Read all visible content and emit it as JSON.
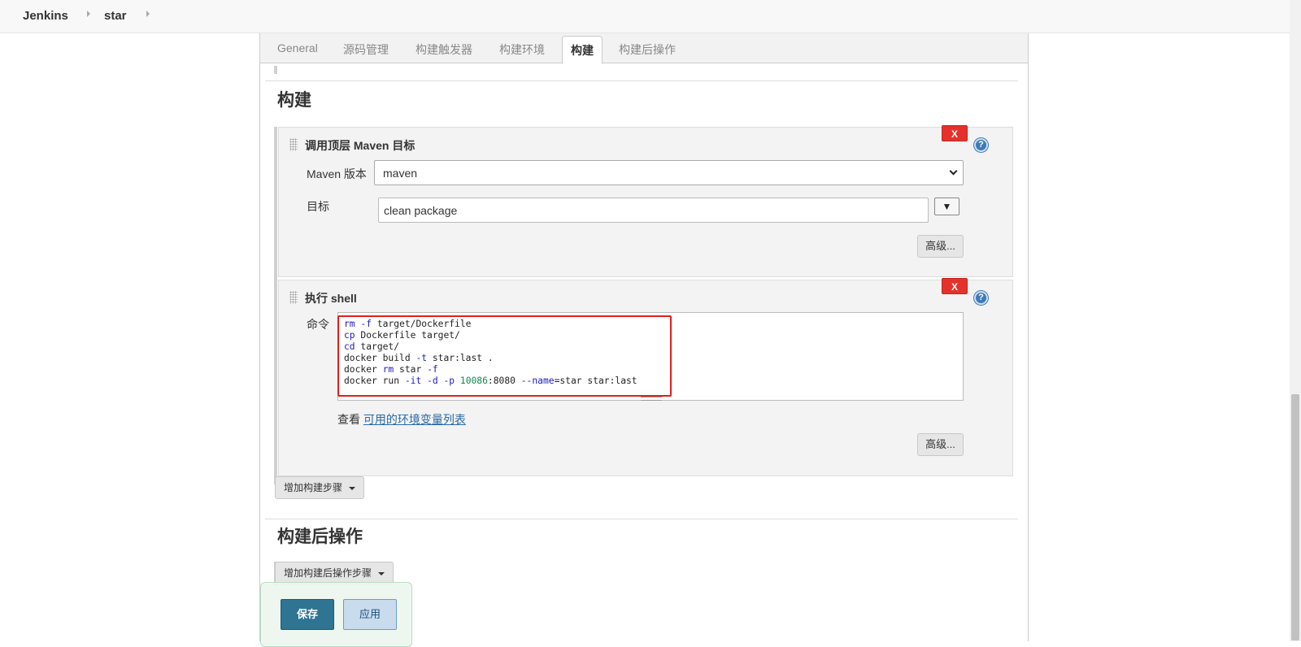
{
  "breadcrumb": {
    "items": [
      "Jenkins",
      "star"
    ]
  },
  "tabs": [
    {
      "label": "General",
      "active": false
    },
    {
      "label": "源码管理",
      "active": false
    },
    {
      "label": "构建触发器",
      "active": false
    },
    {
      "label": "构建环境",
      "active": false
    },
    {
      "label": "构建",
      "active": true
    },
    {
      "label": "构建后操作",
      "active": false
    }
  ],
  "build_section": {
    "title": "构建",
    "maven_step": {
      "title": "调用顶层 Maven 目标",
      "delete_label": "X",
      "help_label": "?",
      "maven_version_label": "Maven 版本",
      "maven_version_value": "maven",
      "goals_label": "目标",
      "goals_value": "clean package",
      "expand_label": "▼",
      "advanced_label": "高级..."
    },
    "shell_step": {
      "title": "执行 shell",
      "delete_label": "X",
      "help_label": "?",
      "command_label": "命令",
      "command_lines": [
        "rm -f target/Dockerfile",
        "cp Dockerfile target/",
        "cd target/",
        "docker build -t star:last .",
        "docker rm star -f",
        "docker run -it -d -p 10086:8080 --name=star star:last"
      ],
      "env_prefix": "查看",
      "env_link": "可用的环境变量列表",
      "advanced_label": "高级..."
    },
    "add_step_label": "增加构建步骤"
  },
  "post_build_section": {
    "title": "构建后操作",
    "add_step_label": "增加构建后操作步骤"
  },
  "actions": {
    "save_label": "保存",
    "apply_label": "应用"
  },
  "colors": {
    "save_button": "#2f7493",
    "apply_button": "#c8dcee",
    "delete_button": "#e4322b",
    "highlight_frame": "#e0201b",
    "link": "#2a6aa8"
  }
}
